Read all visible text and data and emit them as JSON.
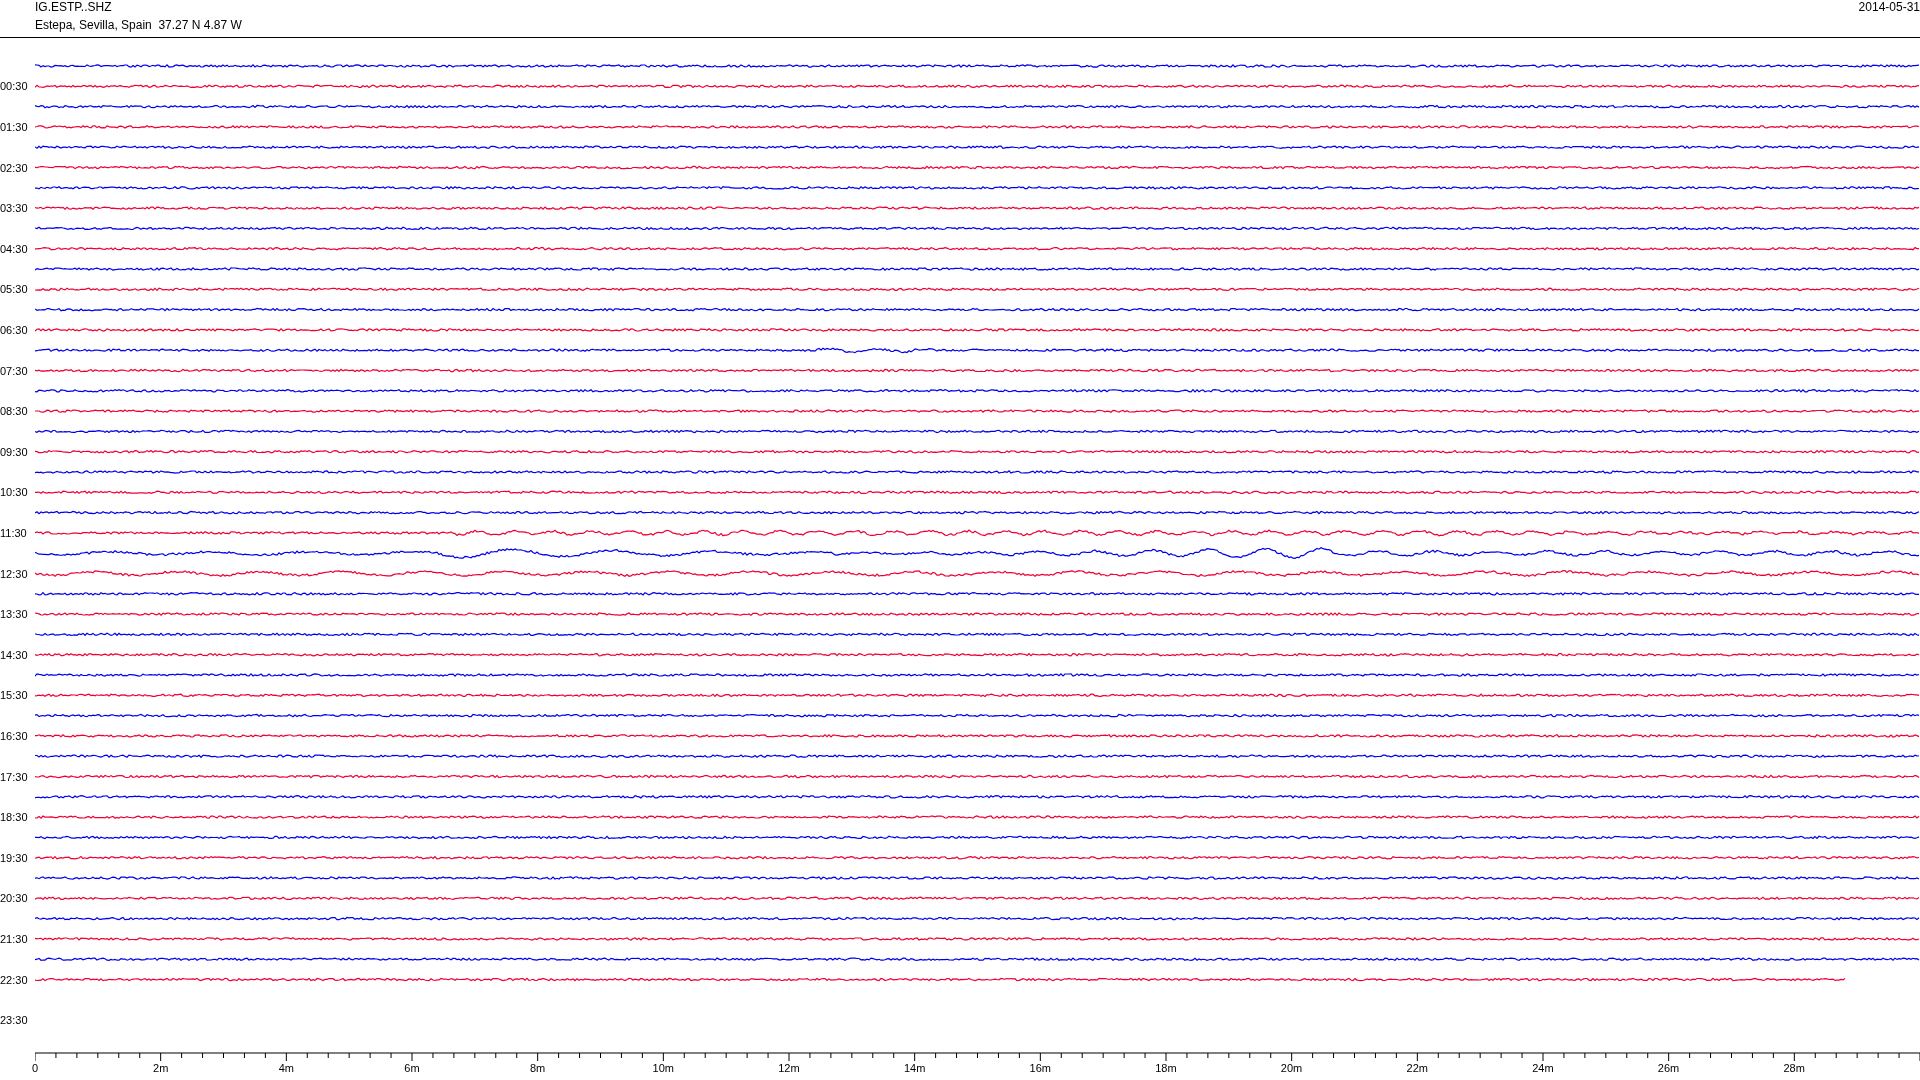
{
  "header": {
    "station": "IG.ESTP..SHZ",
    "location": "Estepa, Sevilla, Spain  37.27 N 4.87 W",
    "date": "2014-05-31"
  },
  "hour_labels": [
    "00:30",
    "01:30",
    "02:30",
    "03:30",
    "04:30",
    "05:30",
    "06:30",
    "07:30",
    "08:30",
    "09:30",
    "10:30",
    "11:30",
    "12:30",
    "13:30",
    "14:30",
    "15:30",
    "16:30",
    "17:30",
    "18:30",
    "19:30",
    "20:30",
    "21:30",
    "22:30",
    "23:30"
  ],
  "x_axis": {
    "labels": [
      "0",
      "2m",
      "4m",
      "6m",
      "8m",
      "10m",
      "12m",
      "14m",
      "16m",
      "18m",
      "20m",
      "22m",
      "24m",
      "26m",
      "28m"
    ]
  }
}
